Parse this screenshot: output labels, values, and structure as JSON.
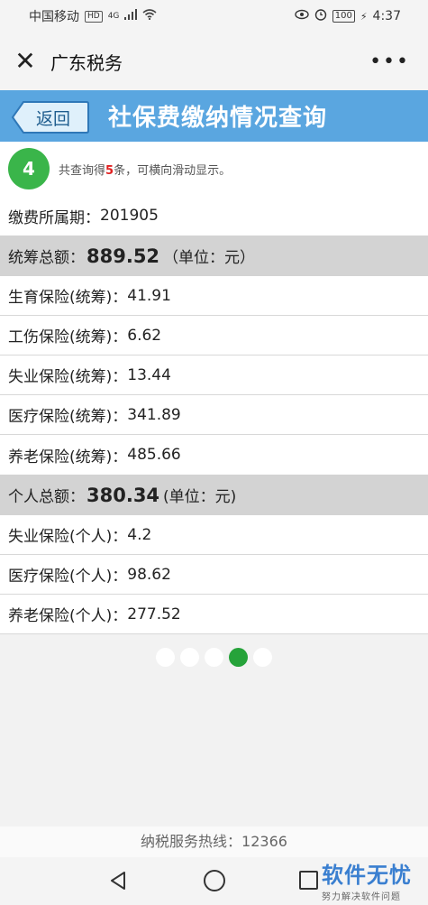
{
  "status_bar": {
    "carrier": "中国移动",
    "hd_badge": "HD",
    "network": "4G",
    "battery": "100",
    "time": "4:37",
    "icons": [
      "eye-icon",
      "alarm-icon",
      "wifi-icon",
      "signal-icon",
      "charging-icon"
    ]
  },
  "title_bar": {
    "close_icon": "close-icon",
    "title": "广东税务",
    "more_icon": "more-icon"
  },
  "header": {
    "back_label": "返回",
    "title": "社保费缴纳情况查询"
  },
  "summary": {
    "count_badge": "4",
    "text_before": "共查询得",
    "count": "5",
    "text_after": "条，可横向滑动显示。"
  },
  "record": {
    "period_label": "缴费所属期：",
    "period_value": "201905",
    "pooled_total_label": "统筹总额：",
    "pooled_total_value": "889.52",
    "pooled_total_unit": "（单位：元）",
    "pooled_items": [
      {
        "label": "生育保险(统筹)：",
        "value": "41.91"
      },
      {
        "label": "工伤保险(统筹)：",
        "value": "6.62"
      },
      {
        "label": "失业保险(统筹)：",
        "value": "13.44"
      },
      {
        "label": "医疗保险(统筹)：",
        "value": "341.89"
      },
      {
        "label": "养老保险(统筹)：",
        "value": "485.66"
      }
    ],
    "personal_total_label": "个人总额：",
    "personal_total_value": "380.34",
    "personal_total_unit": "(单位：元)",
    "personal_items": [
      {
        "label": "失业保险(个人)：",
        "value": "4.2"
      },
      {
        "label": "医疗保险(个人)：",
        "value": "98.62"
      },
      {
        "label": "养老保险(个人)：",
        "value": "277.52"
      }
    ]
  },
  "pager": {
    "total_pages": 5,
    "active_page": 4
  },
  "footer": {
    "hotline": "纳税服务热线：12366"
  },
  "watermark": {
    "line1": "软件无忧",
    "line2": "努力解决软件问题"
  },
  "colors": {
    "header_blue": "#5aa6e0",
    "badge_green": "#3ab54a",
    "count_red": "#e02020",
    "active_dot": "#26a33a"
  }
}
